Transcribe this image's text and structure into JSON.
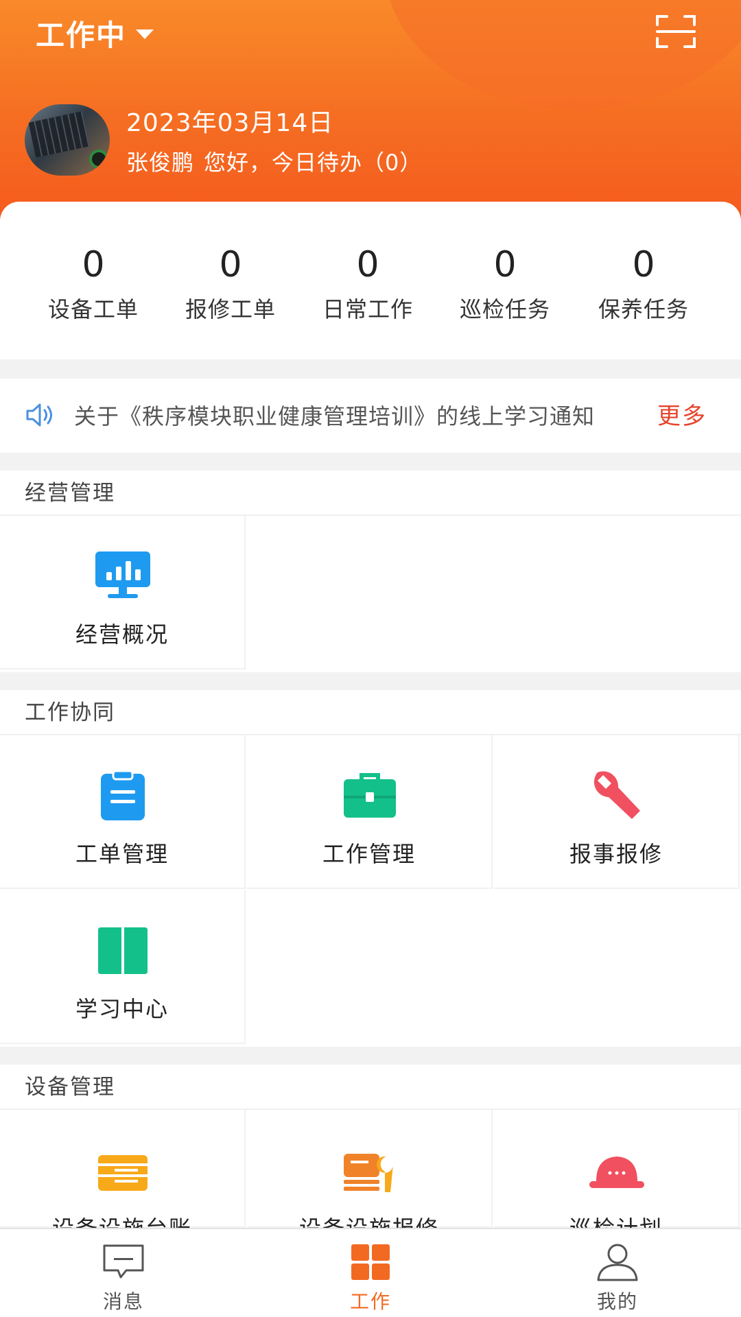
{
  "header": {
    "status": "工作中",
    "date": "2023年03月14日",
    "user_name": "张俊鹏",
    "greeting": "您好，今日待办（0）"
  },
  "stats": [
    {
      "value": "0",
      "label": "设备工单"
    },
    {
      "value": "0",
      "label": "报修工单"
    },
    {
      "value": "0",
      "label": "日常工作"
    },
    {
      "value": "0",
      "label": "巡检任务"
    },
    {
      "value": "0",
      "label": "保养任务"
    }
  ],
  "notice": {
    "text": "关于《秩序模块职业健康管理培训》的线上学习通知",
    "more": "更多"
  },
  "sections": [
    {
      "title": "经营管理",
      "items": [
        {
          "label": "经营概况",
          "icon": "monitor-chart-icon"
        }
      ]
    },
    {
      "title": "工作协同",
      "items": [
        {
          "label": "工单管理",
          "icon": "clipboard-icon"
        },
        {
          "label": "工作管理",
          "icon": "briefcase-icon"
        },
        {
          "label": "报事报修",
          "icon": "wrench-icon"
        },
        {
          "label": "学习中心",
          "icon": "book-icon"
        }
      ]
    },
    {
      "title": "设备管理",
      "items": [
        {
          "label": "设备设施台账",
          "icon": "ledger-icon"
        },
        {
          "label": "设备设施报修",
          "icon": "equipment-repair-icon"
        },
        {
          "label": "巡检计划",
          "icon": "helmet-icon"
        }
      ]
    }
  ],
  "bottom_nav": [
    {
      "label": "消息",
      "icon": "message-icon"
    },
    {
      "label": "工作",
      "icon": "grid-icon"
    },
    {
      "label": "我的",
      "icon": "person-icon"
    }
  ],
  "colors": {
    "brand_orange": "#f56d22",
    "notice_more": "#e5442c",
    "blue_icon": "#1e9bf0",
    "green_icon": "#13c08a",
    "red_icon": "#f0505f",
    "orange_icon": "#f7a91a"
  }
}
